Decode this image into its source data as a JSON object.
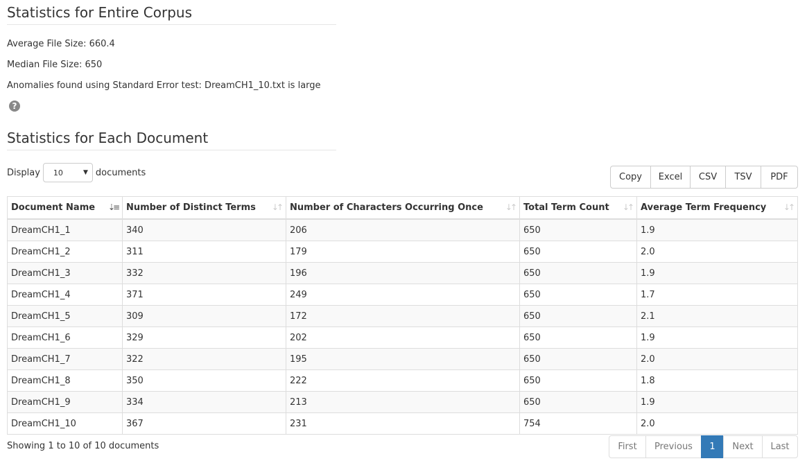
{
  "corpus": {
    "heading": "Statistics for Entire Corpus",
    "avg_size": "Average File Size: 660.4",
    "median_size": "Median File Size: 650",
    "anomalies": "Anomalies found using Standard Error test: DreamCH1_10.txt is large",
    "help_icon": "question-circle-icon"
  },
  "docs": {
    "heading": "Statistics for Each Document",
    "display_label": "Display",
    "display_value": "10",
    "display_suffix": "documents",
    "export_buttons": [
      "Copy",
      "Excel",
      "CSV",
      "TSV",
      "PDF"
    ],
    "columns": [
      "Document Name",
      "Number of Distinct Terms",
      "Number of Characters Occurring Once",
      "Total Term Count",
      "Average Term Frequency"
    ],
    "rows": [
      [
        "DreamCH1_1",
        "340",
        "206",
        "650",
        "1.9"
      ],
      [
        "DreamCH1_2",
        "311",
        "179",
        "650",
        "2.0"
      ],
      [
        "DreamCH1_3",
        "332",
        "196",
        "650",
        "1.9"
      ],
      [
        "DreamCH1_4",
        "371",
        "249",
        "650",
        "1.7"
      ],
      [
        "DreamCH1_5",
        "309",
        "172",
        "650",
        "2.1"
      ],
      [
        "DreamCH1_6",
        "329",
        "202",
        "650",
        "1.9"
      ],
      [
        "DreamCH1_7",
        "322",
        "195",
        "650",
        "2.0"
      ],
      [
        "DreamCH1_8",
        "350",
        "222",
        "650",
        "1.8"
      ],
      [
        "DreamCH1_9",
        "334",
        "213",
        "650",
        "1.9"
      ],
      [
        "DreamCH1_10",
        "367",
        "231",
        "754",
        "2.0"
      ]
    ],
    "info": "Showing 1 to 10 of 10 documents",
    "pagination": [
      "First",
      "Previous",
      "1",
      "Next",
      "Last"
    ],
    "active_page": "1",
    "accent": "#337ab7"
  }
}
